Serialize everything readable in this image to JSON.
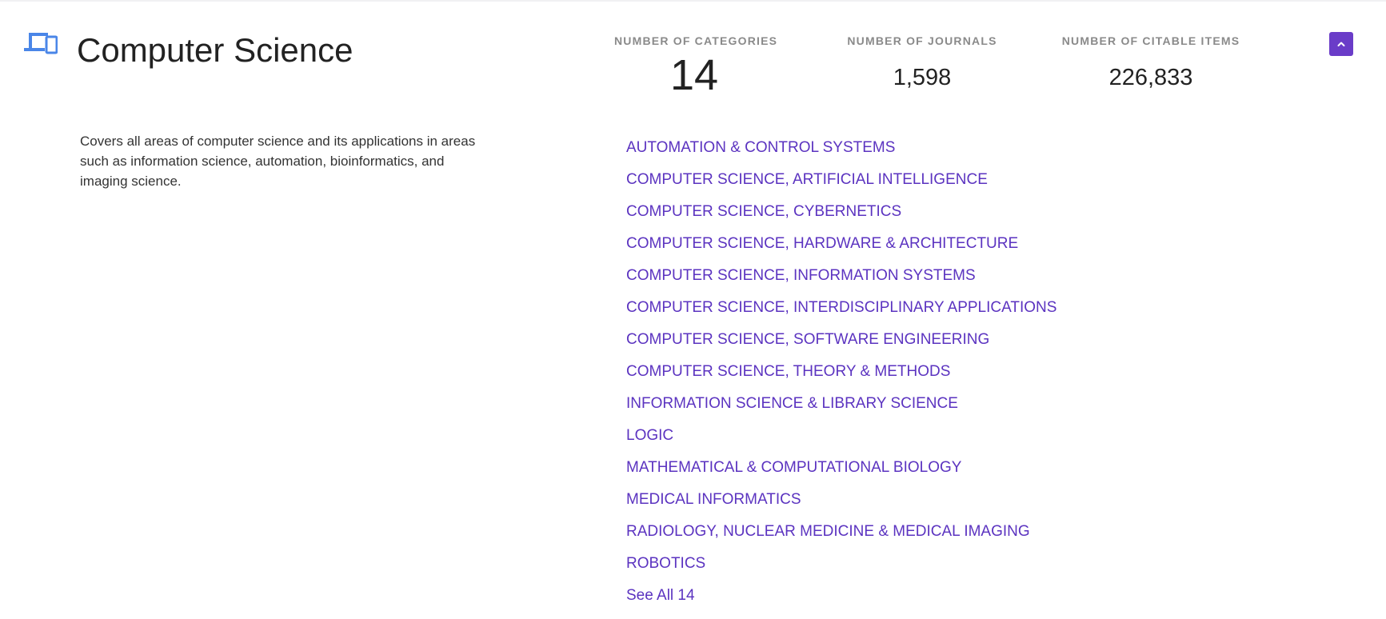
{
  "header": {
    "icon": "devices-icon",
    "title": "Computer Science",
    "collapse_icon": "chevron-up-icon"
  },
  "description": "Covers all areas of computer science and its applications in areas such as information science, automation, bioinformatics, and imaging science.",
  "stats": {
    "categories": {
      "label": "NUMBER OF CATEGORIES",
      "value": "14"
    },
    "journals": {
      "label": "NUMBER OF JOURNALS",
      "value": "1,598"
    },
    "citable": {
      "label": "NUMBER OF CITABLE ITEMS",
      "value": "226,833"
    }
  },
  "categories": [
    "AUTOMATION & CONTROL SYSTEMS",
    "COMPUTER SCIENCE, ARTIFICIAL INTELLIGENCE",
    "COMPUTER SCIENCE, CYBERNETICS",
    "COMPUTER SCIENCE, HARDWARE & ARCHITECTURE",
    "COMPUTER SCIENCE, INFORMATION SYSTEMS",
    "COMPUTER SCIENCE, INTERDISCIPLINARY APPLICATIONS",
    "COMPUTER SCIENCE, SOFTWARE ENGINEERING",
    "COMPUTER SCIENCE, THEORY & METHODS",
    "INFORMATION SCIENCE & LIBRARY SCIENCE",
    "LOGIC",
    "MATHEMATICAL & COMPUTATIONAL BIOLOGY",
    "MEDICAL INFORMATICS",
    "RADIOLOGY, NUCLEAR MEDICINE & MEDICAL IMAGING",
    "ROBOTICS"
  ],
  "see_all_label": "See All 14",
  "colors": {
    "accent": "#5b33c0",
    "button": "#6a3cc8",
    "icon": "#4a86e8"
  }
}
